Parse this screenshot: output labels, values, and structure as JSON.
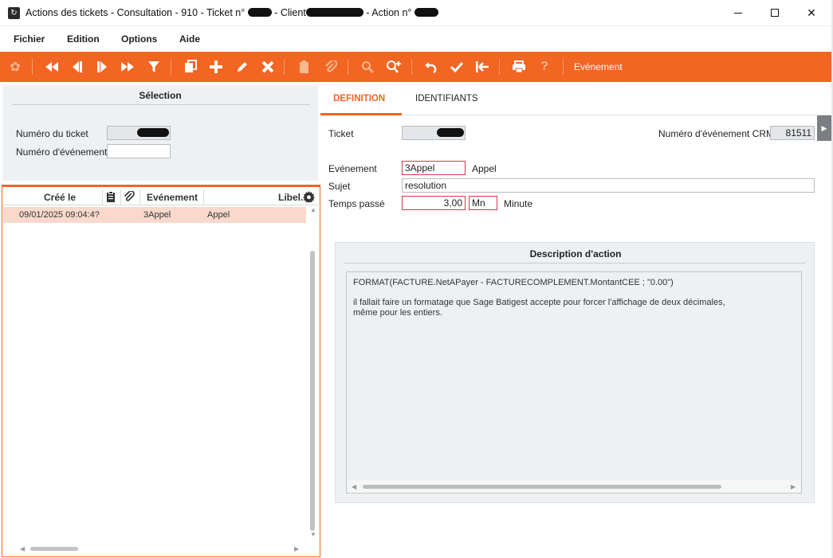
{
  "window": {
    "title_prefix": "Actions des tickets - Consultation -  910     - Ticket n° ",
    "title_client": " - Client",
    "title_action": " - Action n° ",
    "min_glyph": "",
    "max_glyph": "",
    "close_glyph": "✕"
  },
  "menu": [
    "Fichier",
    "Edition",
    "Options",
    "Aide"
  ],
  "toolbar": {
    "label": "Evénement",
    "icons": [
      "palette-icon",
      "first-icon",
      "previous-icon",
      "next-icon",
      "last-icon",
      "filter-icon",
      "copy-icon",
      "add-icon",
      "edit-icon",
      "delete-icon",
      "paste-icon",
      "attach-icon",
      "search-icon",
      "zoom-in-icon",
      "undo-icon",
      "validate-icon",
      "back-icon",
      "print-icon",
      "help-icon"
    ]
  },
  "selection": {
    "title": "Sélection",
    "ticket_label": "Numéro du ticket",
    "event_label": "Numéro d'événement",
    "event_value": ""
  },
  "list": {
    "columns": [
      "Créé le",
      "Evénement",
      "Libel."
    ],
    "rows": [
      {
        "created": "09/01/2025 09:04:4?",
        "event": "3Appel",
        "label": "Appel"
      }
    ]
  },
  "tabs": [
    "DEFINITION",
    "IDENTIFIANTS"
  ],
  "form": {
    "ticket_label": "Ticket",
    "crm_label": "Numéro d'événement CRM",
    "crm_value": "81511",
    "event_label": "Evénement",
    "event_value": "3Appel",
    "event_desc": "Appel",
    "subject_label": "Sujet",
    "subject_value": "resolution",
    "time_label": "Temps passé",
    "time_value": "3,00",
    "unit_value": "Mn",
    "unit_desc": "Minute"
  },
  "description": {
    "title": "Description d'action",
    "lines": [
      "FORMAT(FACTURE.NetAPayer - FACTURECOMPLEMENT.MontantCEE ; \"0.00\")",
      "il fallait faire un formatage que Sage Batigest accepte pour forcer l'affichage de deux décimales,",
      "même pour les entiers."
    ]
  },
  "colors": {
    "accent": "#f26522",
    "panel": "#eef1f3",
    "row_highlight": "#f9d9cc",
    "required_border": "#d2384b"
  }
}
